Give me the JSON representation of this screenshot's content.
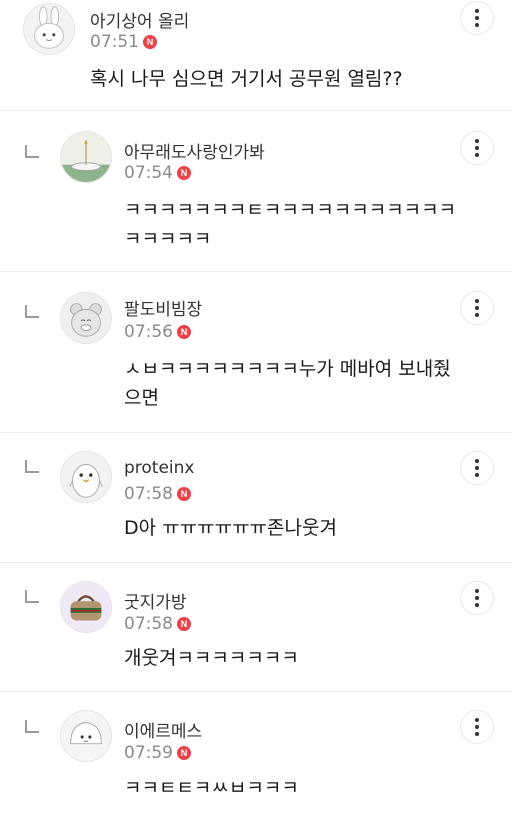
{
  "comments": [
    {
      "nickname": "아기상어 올리",
      "time": "07:51",
      "badge": "N",
      "text": [
        "혹시 나무 심으면 거기서 공무원 열림??"
      ],
      "is_reply": false,
      "avatar_icon": "bunny-avatar"
    },
    {
      "nickname": "아무래도사랑인가봐",
      "time": "07:54",
      "badge": "N",
      "text": [
        "ㅋㅋㅋㅋㅋㅋㅋㅌㅋㅋㅋㅋㅋㅋㅋㅋㅋㅋㅋ",
        "ㅋㅋㅋㅋㅋ"
      ],
      "is_reply": true,
      "avatar_icon": "landscape-avatar"
    },
    {
      "nickname": "팔도비빔장",
      "time": "07:56",
      "badge": "N",
      "text": [
        "ㅅㅂㅋㅋㅋㅋㅋㅋㅋㅋ누가 메바여 보내줬",
        "으면"
      ],
      "is_reply": true,
      "avatar_icon": "round-character-avatar"
    },
    {
      "nickname": "proteinx",
      "time": "07:58",
      "badge": "N",
      "text": [
        "D아 ㅠㅠㅠㅠㅠㅠ존나웃겨"
      ],
      "is_reply": true,
      "avatar_icon": "penguin-avatar"
    },
    {
      "nickname": "굿지가방",
      "time": "07:58",
      "badge": "N",
      "text": [
        "개웃겨ㅋㅋㅋㅋㅋㅋㅋ"
      ],
      "is_reply": true,
      "avatar_icon": "handbag-avatar"
    },
    {
      "nickname": "이에르메스",
      "time": "07:59",
      "badge": "N",
      "text": [
        "ㅋㅋㅌㅌㅋㅆㅂㅋㅋㅋ"
      ],
      "is_reply": true,
      "avatar_icon": "dumpling-avatar"
    }
  ],
  "more_icon": "more-vertical-icon",
  "badge_color": "#e8424a"
}
